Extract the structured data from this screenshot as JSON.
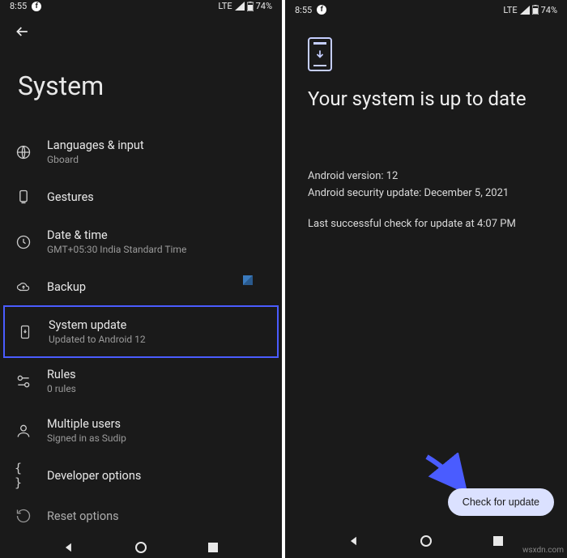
{
  "statusBar": {
    "time": "8:55",
    "network": "LTE",
    "battery": "74%"
  },
  "leftScreen": {
    "title": "System",
    "items": [
      {
        "title": "Languages & input",
        "subtitle": "Gboard",
        "icon": "globe"
      },
      {
        "title": "Gestures",
        "subtitle": "",
        "icon": "gesture"
      },
      {
        "title": "Date & time",
        "subtitle": "GMT+05:30 India Standard Time",
        "icon": "clock"
      },
      {
        "title": "Backup",
        "subtitle": "",
        "icon": "cloud"
      },
      {
        "title": "System update",
        "subtitle": "Updated to Android 12",
        "icon": "phone-down",
        "highlighted": true
      },
      {
        "title": "Rules",
        "subtitle": "0 rules",
        "icon": "rules"
      },
      {
        "title": "Multiple users",
        "subtitle": "Signed in as Sudip",
        "icon": "user"
      },
      {
        "title": "Developer options",
        "subtitle": "",
        "icon": "braces"
      },
      {
        "title": "Reset options",
        "subtitle": "",
        "icon": "reset"
      }
    ]
  },
  "rightScreen": {
    "headline": "Your system is up to date",
    "versionLine": "Android version: 12",
    "securityLine": "Android security update: December 5, 2021",
    "lastCheckLine": "Last successful check for update at 4:07 PM",
    "checkButton": "Check for update"
  },
  "watermark": "wsxdn.com"
}
